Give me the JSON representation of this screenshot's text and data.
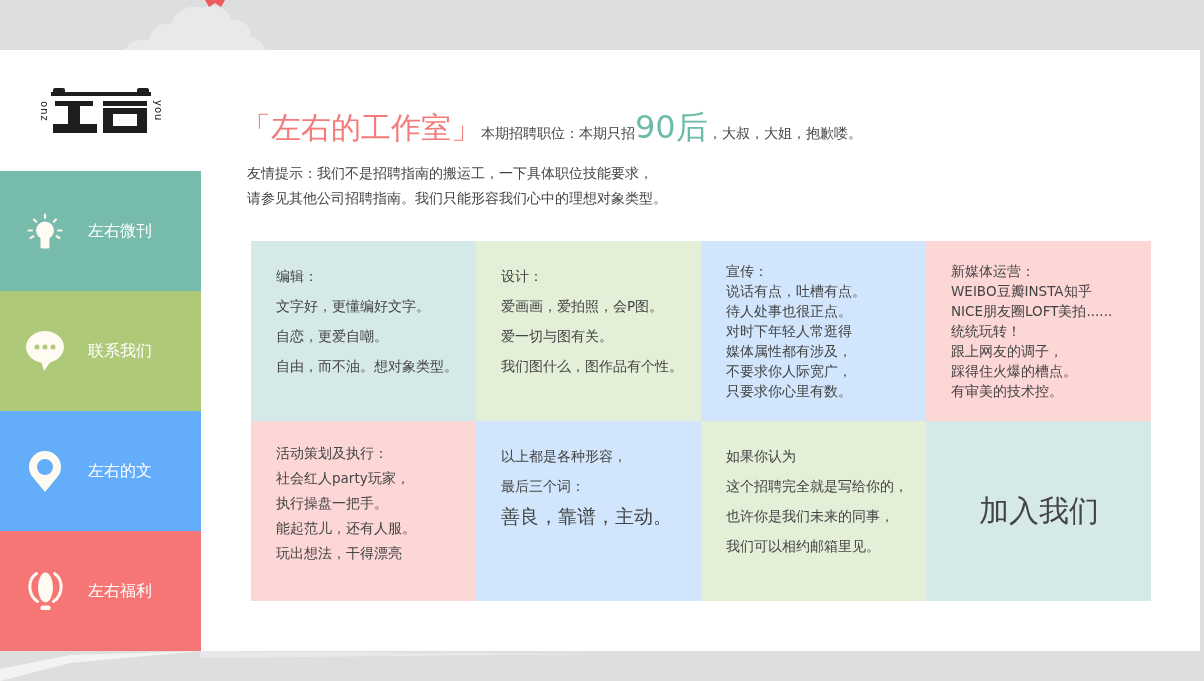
{
  "logo": {
    "left_text": "zuo",
    "right_text": "you"
  },
  "nav": [
    {
      "label": "左右微刊",
      "color": "#76bbac"
    },
    {
      "label": "联系我们",
      "color": "#aec978"
    },
    {
      "label": "左右的文",
      "color": "#63adfb"
    },
    {
      "label": "左右福利",
      "color": "#f67676"
    }
  ],
  "header": {
    "title": "「左右的工作室」",
    "recruit_prefix": "本期招聘职位：本期只招",
    "recruit_highlight": "90后",
    "recruit_suffix": "，大叔，大姐，抱歉喽。",
    "tip_lines": [
      "友情提示：我们不是招聘指南的搬运工，一下具体职位技能要求，",
      "请参见其他公司招聘指南。我们只能形容我们心中的理想对象类型。"
    ]
  },
  "cards": [
    {
      "kind": "spaced",
      "color": "#d5eae8",
      "heading": "编辑：",
      "lines": [
        "文字好，更懂编好文字。",
        "自恋，更爱自嘲。",
        "自由，而不油。想对象类型。"
      ]
    },
    {
      "kind": "spaced",
      "color": "#e4efd8",
      "heading": "设计：",
      "lines": [
        "爱画画，爱拍照，会P图。",
        "爱一切与图有关。",
        "我们图什么，图作品有个性。"
      ]
    },
    {
      "kind": "compact",
      "color": "#d1e6fc",
      "heading": "宣传：",
      "lines": [
        "说话有点，吐槽有点。",
        "待人处事也很正点。",
        "对时下年轻人常逛得",
        "媒体属性都有涉及，",
        "不要求你人际宽广，",
        "只要求你心里有数。"
      ]
    },
    {
      "kind": "compact",
      "color": "#fdd6d6",
      "heading": "新媒体运营：",
      "lines": [
        "WEIBO豆瓣INSTA知乎",
        "NICE朋友圈LOFT美拍......",
        "统统玩转！",
        "跟上网友的调子，",
        "踩得住火爆的槽点。",
        "有审美的技术控。"
      ]
    },
    {
      "kind": "snug",
      "color": "#fdd6d6",
      "heading": "活动策划及执行：",
      "lines": [
        "社会红人party玩家，",
        "执行操盘一把手。",
        "能起范儿，还有人服。",
        "玩出想法，干得漂亮"
      ]
    },
    {
      "kind": "motto",
      "color": "#d1e6fc",
      "lines": [
        "以上都是各种形容，",
        "最后三个词："
      ],
      "motto": "善良，靠谱，主动。"
    },
    {
      "kind": "paragraph",
      "color": "#e4efd8",
      "lines": [
        "如果你认为",
        "这个招聘完全就是写给你的，",
        "也许你是我们未来的同事，",
        "我们可以相约邮箱里见。"
      ]
    },
    {
      "kind": "cta",
      "color": "#d5eae8",
      "label": "加入我们"
    }
  ]
}
